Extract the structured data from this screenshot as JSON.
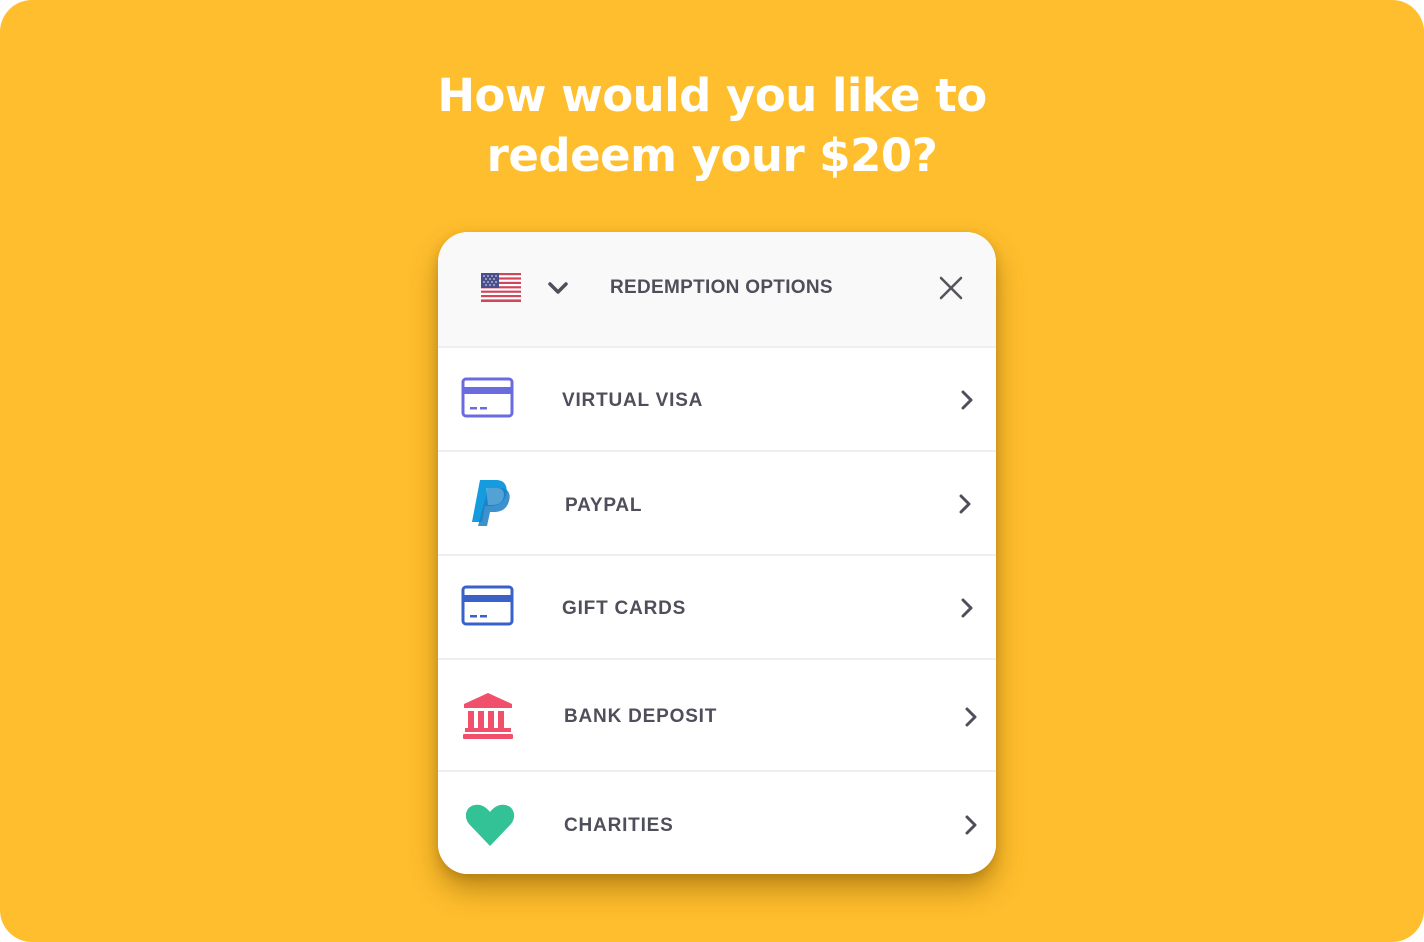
{
  "headline": {
    "line1": "How would you like to",
    "line2": "redeem your $20?"
  },
  "colors": {
    "background": "#FFBE2D",
    "text_dark": "#4F4F5B",
    "visa_icon": "#6B6BE0",
    "paypal_icon": "#169BDE",
    "giftcard_icon": "#3961C8",
    "bank_icon": "#F0506B",
    "charity_icon": "#33C196"
  },
  "modal": {
    "country": "United States",
    "country_icon": "us-flag-icon",
    "title": "REDEMPTION OPTIONS",
    "close_icon": "close-icon",
    "options": [
      {
        "label": "VIRTUAL VISA",
        "icon": "credit-card-icon"
      },
      {
        "label": "PAYPAL",
        "icon": "paypal-icon"
      },
      {
        "label": "GIFT CARDS",
        "icon": "credit-card-icon"
      },
      {
        "label": "BANK DEPOSIT",
        "icon": "bank-icon"
      },
      {
        "label": "CHARITIES",
        "icon": "heart-icon"
      }
    ]
  }
}
